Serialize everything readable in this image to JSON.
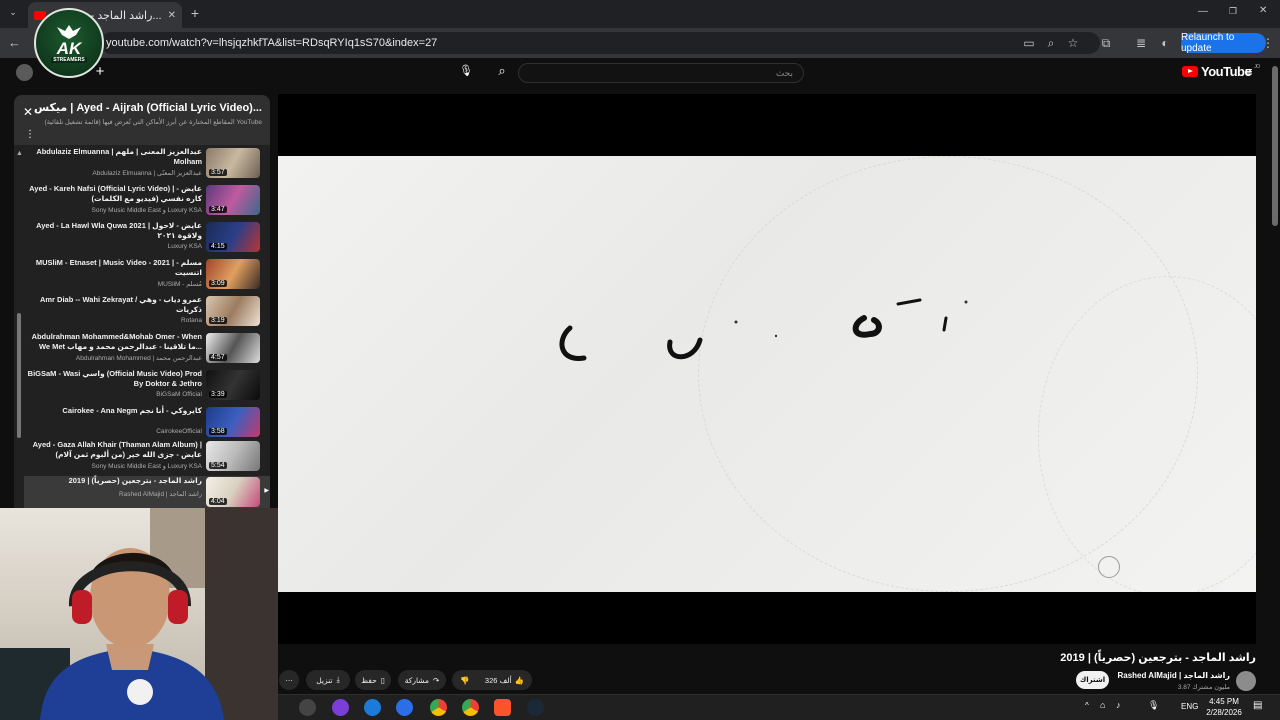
{
  "browser": {
    "tab_title": "راشد الماجد - بتر...",
    "url": "youtube.com/watch?v=lhsjqzhkfTA&list=RDsqRYIq1sS70&index=27",
    "relaunch_label": "Relaunch to update"
  },
  "logo": {
    "text_main": "AK",
    "text_sub": "STREAMERS"
  },
  "youtube": {
    "search_placeholder": "بحث",
    "logo_text": "YouTube",
    "logo_region": "JO"
  },
  "playlist": {
    "title": "ميكس | Ayed - Aijrah (Official Lyric Video)...",
    "subtitle": "المقاطع المختارة عن أبرز الأماكن التي تُعرض فيها (قائمة تشغيل تلقائية) YouTube",
    "items": [
      {
        "title": "Abdulaziz Elmuanna | عبدالعزيز المعنى | ملهم Molham",
        "channel": "Abdulaziz Elmuanna | عبدالعزيز المعنّى",
        "duration": "3:57"
      },
      {
        "title": "Ayed - Kareh Nafsi (Official Lyric Video) | عايض - كاره نفسي (فيديو مع الكلمات)",
        "channel": "Sony Music Middle East و Luxury KSA",
        "duration": "3:47"
      },
      {
        "title": "Ayed - La Hawl Wla Quwa 2021 | عايض - لاحول ولاقوة ٢٠٢١",
        "channel": "Luxury KSA",
        "duration": "4:15"
      },
      {
        "title": "MUSliM - Etnaset | Music Video - 2021 | مسلم - اتنسيت",
        "channel": "MUSliM - مُسلم",
        "duration": "3:09"
      },
      {
        "title": "Amr Diab -- Wahi Zekrayat / عمرو دياب - وهي ذكريات",
        "channel": "Rotana",
        "duration": "3:19"
      },
      {
        "title": "Abdulrahman Mohammed&Mohab Omer - When We Met ما تلاقينا - عبدالرحمن محمد و مهاب...",
        "channel": "Abdulrahman Mohammed | عبدالرحمن محمد",
        "duration": "4:57"
      },
      {
        "title": "BiGSaM - Wasi واسي (Official Music Video) Prod By Doktor & Jethro",
        "channel": "BiGSaM Official",
        "duration": "3:39"
      },
      {
        "title": "Cairokee - Ana Negm كايروكي - أنا نجم",
        "channel": "CairokeeOfficial",
        "duration": "3:58"
      },
      {
        "title": "Ayed - Gaza Allah Khair (Thaman Alam Album) | عايض - جزى الله خير (من ألبوم ثمن آلام)",
        "channel": "Sony Music Middle East و Luxury KSA",
        "duration": "5:54"
      },
      {
        "title": "راشد الماجد - بترجعين (حصرياً) | 2019",
        "channel": "Rashed AlMajid | راشد الماجد",
        "duration": "4:04"
      }
    ]
  },
  "video": {
    "title": "راشد الماجد - بترجعين (حصرياً) | 2019",
    "channel_name": "Rashed AlMajid | راشد الماجد",
    "subscribers": "3.87 مليون مشترك",
    "subscribe_label": "اشتراك",
    "likes_label": "326 ألف",
    "share_label": "مشاركة",
    "save_label": "حفظ",
    "download_label": "تنزيل"
  },
  "taskbar": {
    "language": "ENG",
    "time": "4:45 PM",
    "date": "2/28/2026"
  },
  "colors": {
    "youtube_red": "#ff0000",
    "chrome_blue": "#1a73e8",
    "page_bg": "#0f0f0f"
  }
}
